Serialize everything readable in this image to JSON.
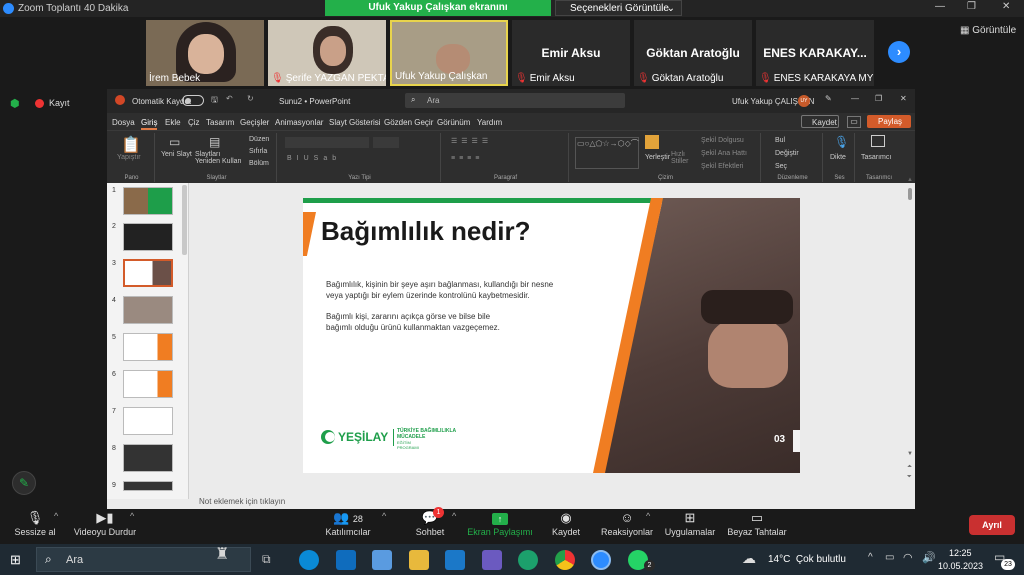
{
  "window": {
    "title": "Zoom Toplantı 40 Dakika"
  },
  "share": {
    "banner": "Ufuk Yakup Çalışkan ekranını görüntülüyorsunuz",
    "view_options": "Seçenekleri Görüntüle"
  },
  "gallery": {
    "participants": [
      {
        "name": "İrem Bebek"
      },
      {
        "name": "Şerife YAZGAN PEKTAŞ"
      },
      {
        "name": "Ufuk Yakup Çalışkan"
      },
      {
        "name": "Emir Aksu",
        "big": "Emir Aksu"
      },
      {
        "name": "Göktan Aratoğlu",
        "big": "Göktan Aratoğlu"
      },
      {
        "name": "ENES KARAKAYA MYİ",
        "big": "ENES KARAKAY..."
      }
    ],
    "view_label": "Görüntüle"
  },
  "left": {
    "record": "Kayıt"
  },
  "ppt": {
    "autosave": "Otomatik Kaydet",
    "filename": "Sunu2 • PowerPoint",
    "search": "Ara",
    "user": "Ufuk Yakup ÇALIŞKAN",
    "user_initials": "UY",
    "save_btn": "Kaydet",
    "share_btn": "Paylaş",
    "menu": [
      "Dosya",
      "Giriş",
      "Ekle",
      "Çiz",
      "Tasarım",
      "Geçişler",
      "Animasyonlar",
      "Slayt Gösterisi",
      "Gözden Geçir",
      "Görünüm",
      "Yardım"
    ],
    "ribbon": {
      "paste": "Yapıştır",
      "clipboard": "Pano",
      "new_slide": "Yeni Slayt",
      "reuse": "Slaytları Yeniden Kullan",
      "layout": "Düzen",
      "reset": "Sıfırla",
      "section": "Bölüm",
      "slides": "Slaytlar",
      "font": "Yazı Tipi",
      "paragraph": "Paragraf",
      "arrange": "Yerleştir",
      "quick_styles": "Hızlı Stiller",
      "shape_fill": "Şekil Dolgusu",
      "shape_outline": "Şekil Ana Hattı",
      "shape_effects": "Şekil Efektleri",
      "drawing": "Çizim",
      "find": "Bul",
      "replace": "Değiştir",
      "select": "Seç",
      "editing": "Düzenleme",
      "dictate": "Dikte",
      "voice": "Ses",
      "designer": "Tasarımcı"
    },
    "thumb_numbers": [
      "1",
      "2",
      "3",
      "4",
      "5",
      "6",
      "7",
      "8",
      "9"
    ],
    "notes": "Not eklemek için tıklayın"
  },
  "slide": {
    "title": "Bağımlılık nedir?",
    "para1_l1": "Bağımlılık, kişinin bir şeye aşırı bağlanması, kullandığı bir nesne",
    "para1_l2": "veya yaptığı bir eylem üzerinde kontrolünü kaybetmesidir.",
    "para2_l1": "Bağımlı kişi, zararını açıkça görse ve bilse bile",
    "para2_l2": "bağımlı olduğu ürünü kullanmaktan vazgeçemez.",
    "logo": "YEŞİLAY",
    "logo_sub1": "TÜRKİYE BAĞIMLILIKLA",
    "logo_sub2": "MÜCADELE",
    "logo_sub3": "EĞİTİM PROGRAMI",
    "page": "03",
    "colors": {
      "green": "#1e9e4a",
      "orange": "#f07d22"
    }
  },
  "toolbar": {
    "mute": "Sessize al",
    "video": "Videoyu Durdur",
    "participants": "Katılımcılar",
    "participants_count": "28",
    "chat": "Sohbet",
    "chat_badge": "1",
    "share": "Ekran Paylaşımı",
    "record": "Kaydet",
    "reactions": "Reaksiyonlar",
    "apps": "Uygulamalar",
    "whiteboard": "Beyaz Tahtalar",
    "leave": "Ayrıl"
  },
  "taskbar": {
    "search": "Ara",
    "weather": "14°C  Çok bulutlu",
    "time": "12:25",
    "date": "10.05.2023",
    "notif": "23",
    "whatsapp_badge": "2"
  }
}
